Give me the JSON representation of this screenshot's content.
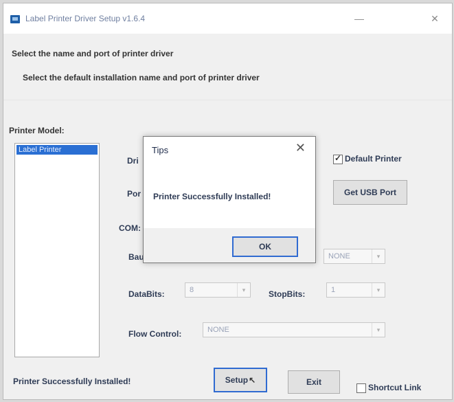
{
  "window": {
    "title": "Label Printer Driver Setup v1.6.4",
    "minimize": "—",
    "close": "✕"
  },
  "section": {
    "title": "Select the name and port of printer driver",
    "description": "Select the default installation name and port of printer driver"
  },
  "printer_model": {
    "label": "Printer Model:",
    "items": [
      "Label Printer"
    ]
  },
  "driver": {
    "label": "Dri",
    "default_printer": "Default Printer",
    "default_checked": true
  },
  "port": {
    "label": "Por",
    "get_usb_button": "Get USB Port"
  },
  "com": {
    "label": "COM:",
    "baud_label": "Bau",
    "parity_value": "NONE",
    "databits_label": "DataBits:",
    "databits_value": "8",
    "stopbits_label": "StopBits:",
    "stopbits_value": "1",
    "flow_label": "Flow Control:",
    "flow_value": "NONE"
  },
  "footer": {
    "status": "Printer Successfully Installed!",
    "setup_button": "Setup",
    "exit_button": "Exit",
    "shortcut_label": "Shortcut Link",
    "shortcut_checked": false
  },
  "dialog": {
    "title": "Tips",
    "close": "✕",
    "message": "Printer Successfully Installed!",
    "ok_button": "OK"
  }
}
